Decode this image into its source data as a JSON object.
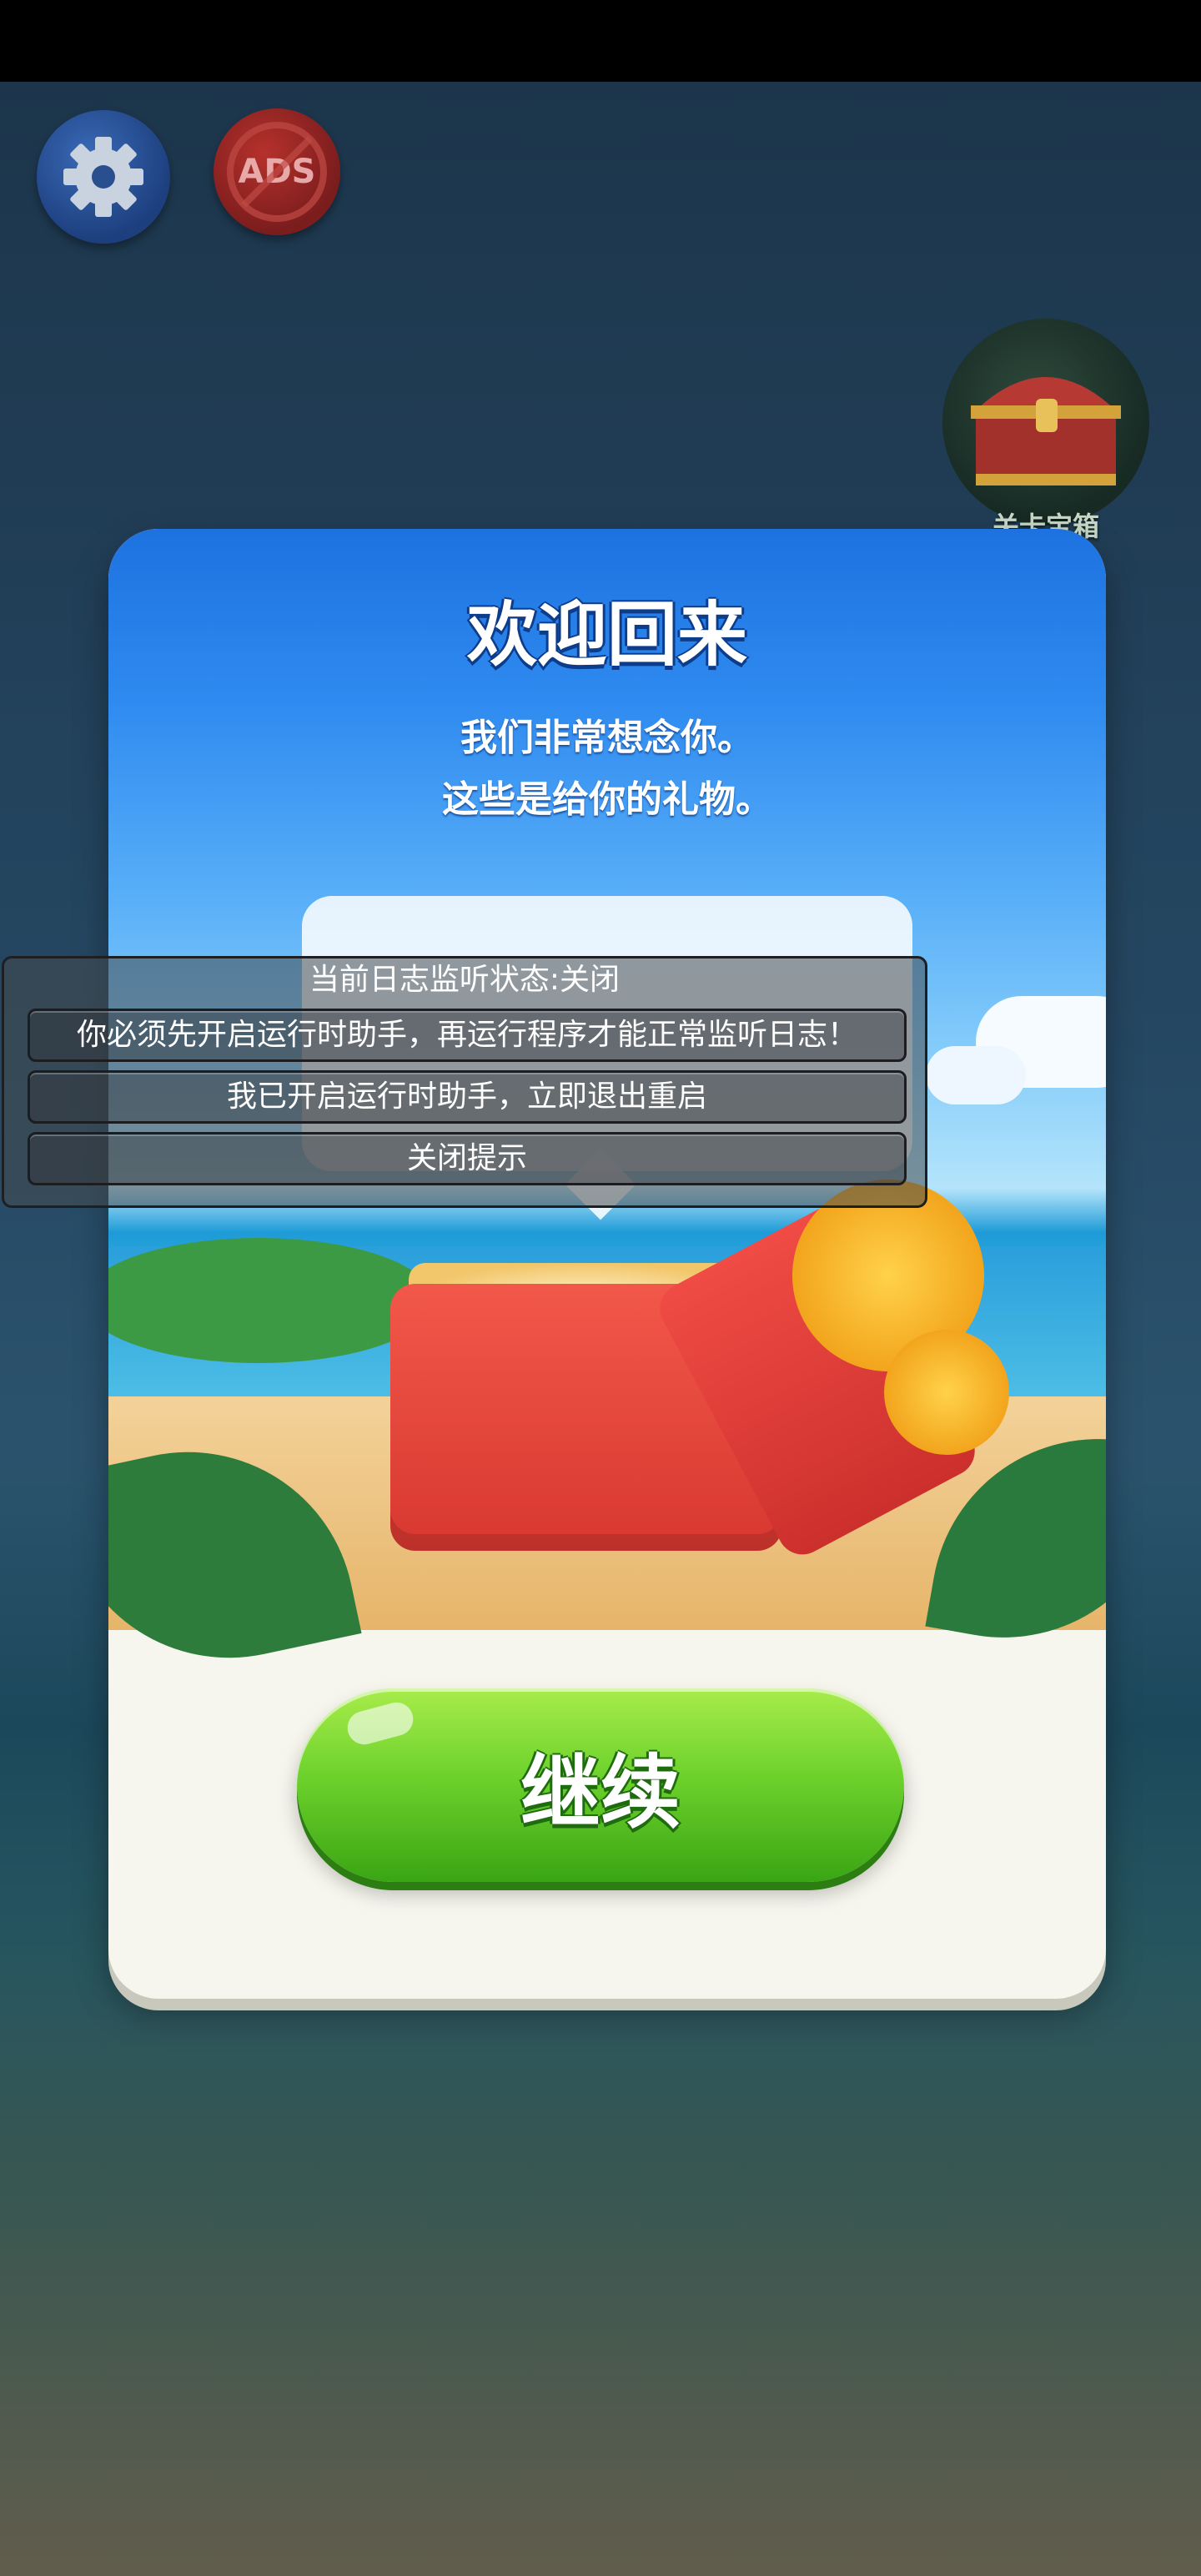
{
  "top_bar": {
    "ads_label": "ADS",
    "chest_label": "关卡宝箱"
  },
  "dialog": {
    "title": "欢迎回来",
    "subtitle_line1": "我们非常想念你。",
    "subtitle_line2": "这些是给你的礼物。",
    "continue_label": "继续"
  },
  "log_panel": {
    "status_text": "当前日志监听状态:关闭",
    "message": "你必须先开启运行时助手，再运行程序才能正常监听日志！",
    "restart_button_label": "我已开启运行时助手，立即退出重启",
    "close_button_label": "关闭提示"
  },
  "colors": {
    "continue_button": "#6ed22c",
    "title_outline": "#0d3d8a",
    "dialog_background": "#f6f6ee"
  }
}
